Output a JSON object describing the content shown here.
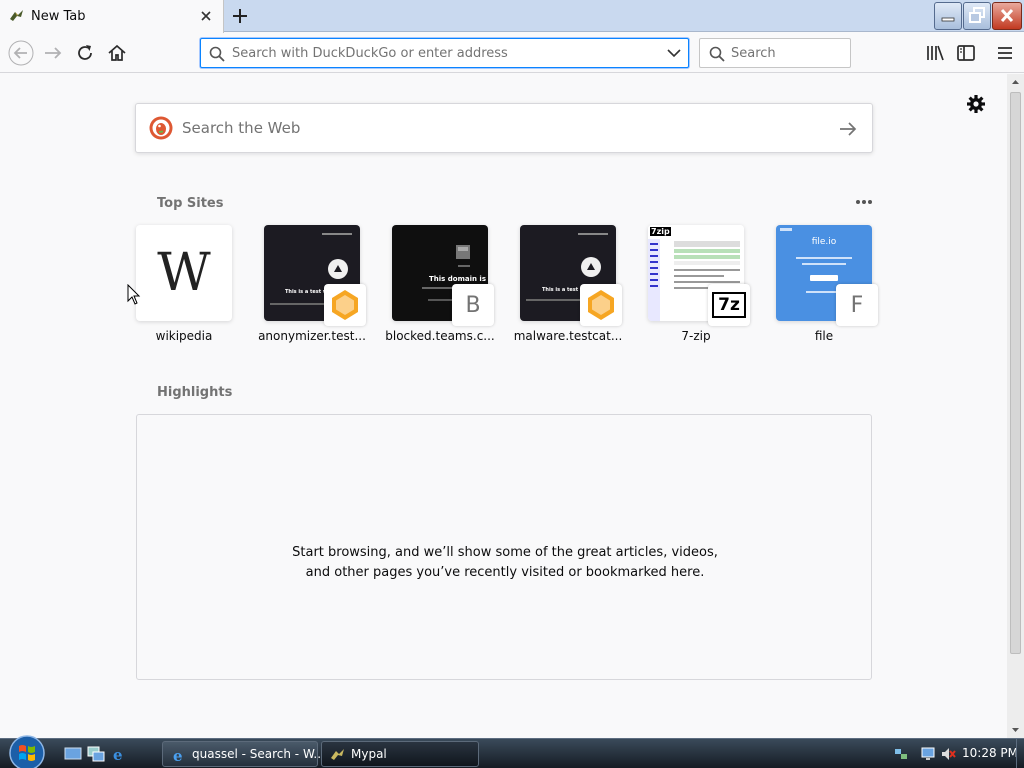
{
  "window": {
    "tab_title": "New Tab"
  },
  "toolbar": {
    "url_placeholder": "Search with DuckDuckGo or enter address",
    "search_placeholder": "Search"
  },
  "newtab": {
    "web_search_placeholder": "Search the Web",
    "top_sites_title": "Top Sites",
    "top_sites": [
      {
        "label": "wikipedia",
        "badge": ""
      },
      {
        "label": "anonymizer.test...",
        "badge": ""
      },
      {
        "label": "blocked.teams.c...",
        "badge": "B"
      },
      {
        "label": "malware.testcat...",
        "badge": ""
      },
      {
        "label": "7-zip",
        "badge": ""
      },
      {
        "label": "file",
        "badge": "F"
      }
    ],
    "thumb_texts": {
      "wikipedia_logo": "W",
      "anon_text": "This is a test website",
      "blocked_text": "This domain is bloc",
      "malware_text": "This is a test website",
      "sevenzip_logo": "7z",
      "sevenzip_header": "7zip",
      "file_title": "file.io"
    },
    "highlights_title": "Highlights",
    "highlights_empty": "Start browsing, and we’ll show some of the great articles, videos, and other pages you’ve recently visited or bookmarked here."
  },
  "taskbar": {
    "tasks": [
      {
        "label": "quassel - Search - W..."
      },
      {
        "label": "Mypal"
      }
    ],
    "clock": "10:28 PM"
  },
  "colors": {
    "accent": "#0a84ff",
    "tabbar": "#c9d9ef",
    "page_bg": "#f9f9fa"
  }
}
